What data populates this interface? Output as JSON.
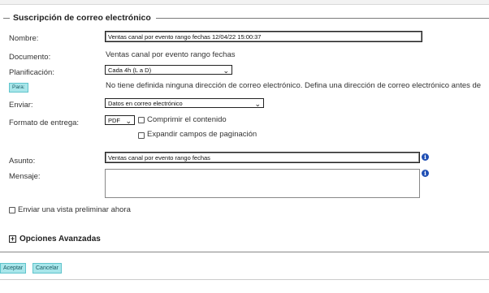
{
  "fieldset": {
    "title": "Suscripción de correo electrónico"
  },
  "nombre": {
    "label": "Nombre:",
    "value": "Ventas canal por evento rango fechas 12/04/22 15:00:37"
  },
  "documento": {
    "label": "Documento:",
    "value": "Ventas canal por evento rango fechas"
  },
  "planificacion": {
    "label": "Planificación:",
    "selected": "Cada 4h (L a D)"
  },
  "para": {
    "button": "Para:",
    "message": "No tiene definida ninguna dirección de correo electrónico. Defina una dirección de correo electrónico antes de"
  },
  "enviar": {
    "label": "Enviar:",
    "selected": "Datos en correo electrónico"
  },
  "formato": {
    "label": "Formato de entrega:",
    "selected": "PDF",
    "comprimir": "Comprimir el contenido",
    "expandir": "Expandir campos de paginación"
  },
  "asunto": {
    "label": "Asunto:",
    "value": "Ventas canal por evento rango fechas"
  },
  "mensaje": {
    "label": "Mensaje:",
    "value": ""
  },
  "preliminar": {
    "label": "Enviar una vista preliminar ahora"
  },
  "avanzadas": {
    "label": "Opciones Avanzadas"
  },
  "actions": {
    "accept": "Aceptar",
    "cancel": "Cancelar"
  },
  "icons": {
    "info": "info-icon",
    "chevron": "chevron-down-icon",
    "expand": "plus-box-icon"
  },
  "colors": {
    "button_bg": "#a8e6ea",
    "button_border": "#5fc4cc",
    "info_icon": "#1f4fb4"
  }
}
